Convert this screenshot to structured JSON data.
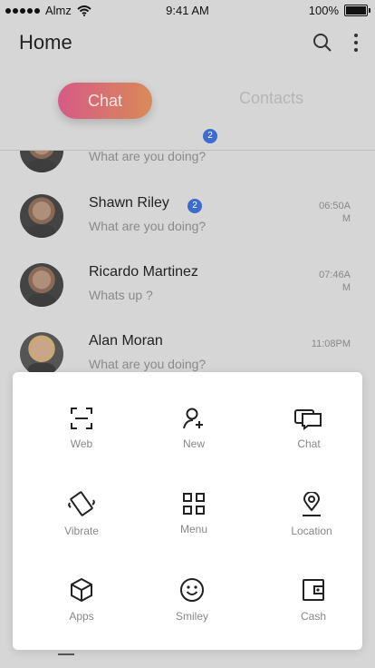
{
  "status_bar": {
    "carrier": "Almz",
    "time": "9:41 AM",
    "battery": "100%"
  },
  "header": {
    "title": "Home",
    "search_icon": "search-icon",
    "more_icon": "more-vertical-icon"
  },
  "tabs": {
    "chat": "Chat",
    "contacts": "Contacts",
    "badge": "2"
  },
  "chats": [
    {
      "name": "",
      "message": "What are you doing?",
      "time": "",
      "unread": ""
    },
    {
      "name": "Shawn Riley",
      "message": "What are you doing?",
      "time": "06:50AM",
      "unread": "2"
    },
    {
      "name": "Ricardo Martinez",
      "message": "Whats up ?",
      "time": "07:46AM",
      "unread": ""
    },
    {
      "name": "Alan Moran",
      "message": "What are you doing?",
      "time": "11:08PM",
      "unread": ""
    }
  ],
  "actions": [
    {
      "label": "Web",
      "icon": "scan-icon"
    },
    {
      "label": "New",
      "icon": "add-user-icon"
    },
    {
      "label": "Chat",
      "icon": "chat-bubbles-icon"
    },
    {
      "label": "Vibrate",
      "icon": "vibrate-icon"
    },
    {
      "label": "Menu",
      "icon": "grid-menu-icon"
    },
    {
      "label": "Location",
      "icon": "location-pin-icon"
    },
    {
      "label": "Apps",
      "icon": "box-icon"
    },
    {
      "label": "Smiley",
      "icon": "smiley-icon"
    },
    {
      "label": "Cash",
      "icon": "wallet-icon"
    }
  ]
}
